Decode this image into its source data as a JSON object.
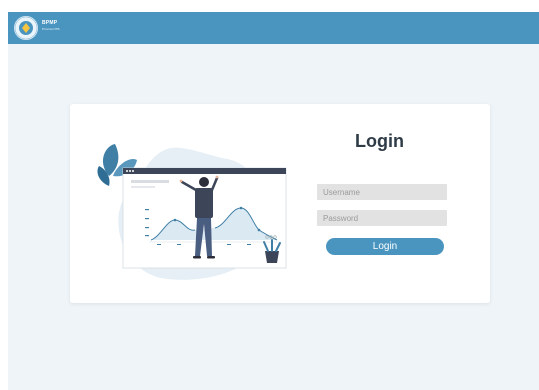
{
  "header": {
    "brand_title": "BPMP",
    "brand_subtitle": "Provinsi NTB",
    "accent_color": "#4a95c0"
  },
  "login": {
    "title": "Login",
    "username_placeholder": "Username",
    "password_placeholder": "Password",
    "username_value": "",
    "password_value": "",
    "button_label": "Login"
  },
  "icons": [
    "logo-emblem-icon",
    "analytics-illustration-icon"
  ]
}
